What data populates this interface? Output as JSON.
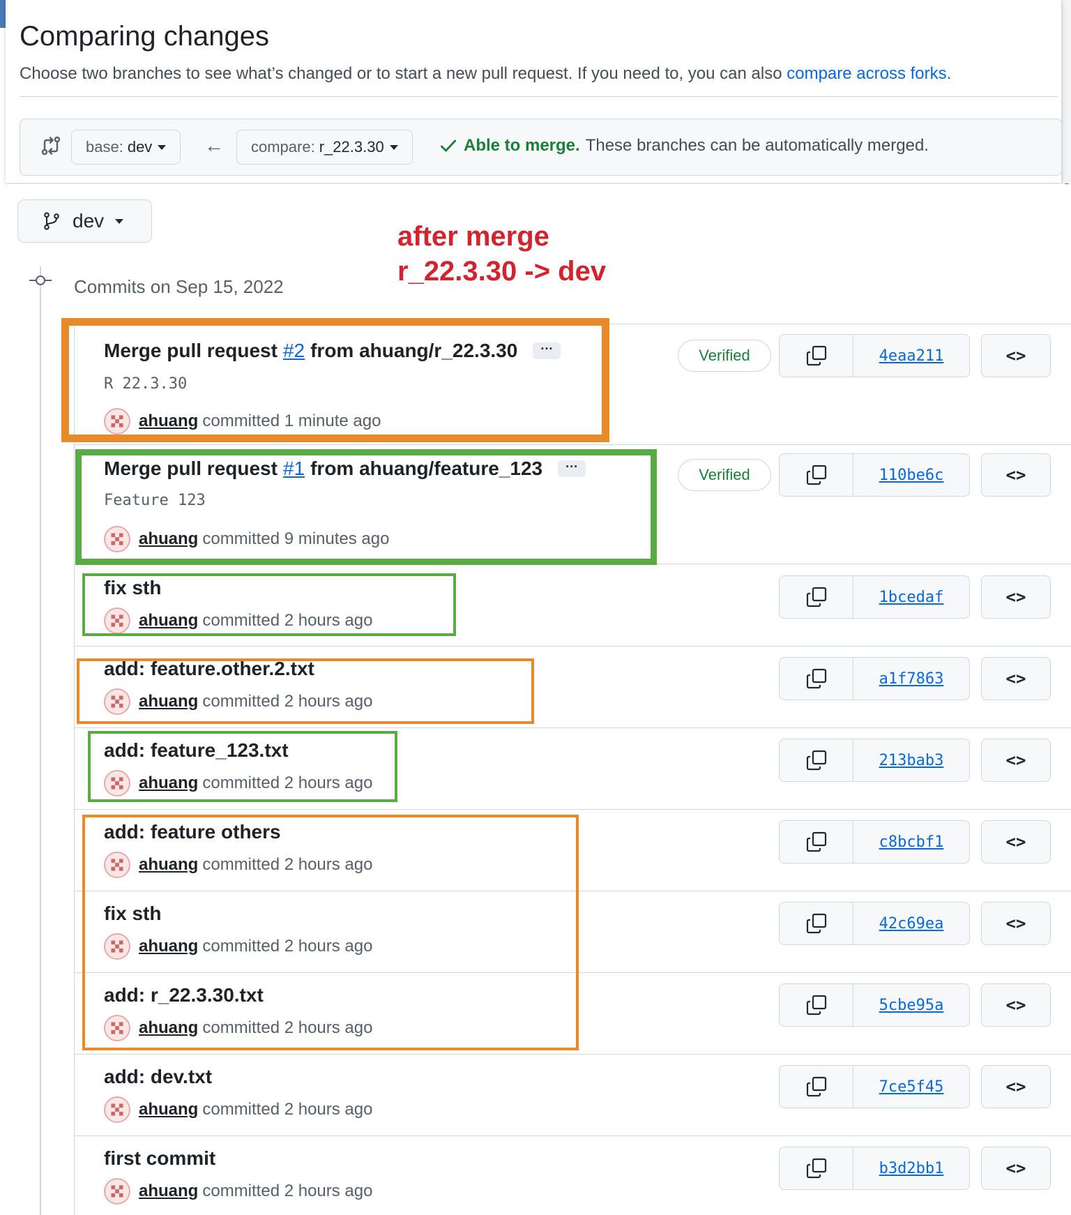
{
  "header": {
    "title": "Comparing changes",
    "description": "Choose two branches to see what’s changed or to start a new pull request. If you need to, you can also ",
    "forks_link": "compare across forks."
  },
  "range": {
    "base_label": "base:",
    "base_branch": "dev",
    "compare_label": "compare:",
    "compare_branch": "r_22.3.30",
    "merge_ok": "Able to merge.",
    "merge_text": "These branches can be automatically merged."
  },
  "branch_selector": {
    "branch": "dev"
  },
  "annotation": {
    "line1": "after merge",
    "line2": "r_22.3.30 -> dev"
  },
  "commit_group": {
    "heading": "Commits on Sep 15, 2022"
  },
  "commits": [
    {
      "title_pre": "Merge pull request",
      "pr": "#2",
      "title_post": "from ahuang/r_22.3.30",
      "body": "R 22.3.30",
      "author": "ahuang",
      "time": "committed 1 minute ago",
      "verified": "Verified",
      "sha": "4eaa211"
    },
    {
      "title_pre": "Merge pull request",
      "pr": "#1",
      "title_post": "from ahuang/feature_123",
      "body": "Feature 123",
      "author": "ahuang",
      "time": "committed 9 minutes ago",
      "verified": "Verified",
      "sha": "110be6c"
    },
    {
      "title": "fix sth",
      "author": "ahuang",
      "time": "committed 2 hours ago",
      "sha": "1bcedaf"
    },
    {
      "title": "add: feature.other.2.txt",
      "author": "ahuang",
      "time": "committed 2 hours ago",
      "sha": "a1f7863"
    },
    {
      "title": "add: feature_123.txt",
      "author": "ahuang",
      "time": "committed 2 hours ago",
      "sha": "213bab3"
    },
    {
      "title": "add: feature others",
      "author": "ahuang",
      "time": "committed 2 hours ago",
      "sha": "c8bcbf1"
    },
    {
      "title": "fix sth",
      "author": "ahuang",
      "time": "committed 2 hours ago",
      "sha": "42c69ea"
    },
    {
      "title": "add: r_22.3.30.txt",
      "author": "ahuang",
      "time": "committed 2 hours ago",
      "sha": "5cbe95a"
    },
    {
      "title": "add: dev.txt",
      "author": "ahuang",
      "time": "committed 2 hours ago",
      "sha": "7ce5f45"
    },
    {
      "title": "first commit",
      "author": "ahuang",
      "time": "committed 2 hours ago",
      "sha": "b3d2bb1"
    }
  ],
  "icons": {
    "compare": "git-compare-icon",
    "branch": "git-branch-icon",
    "commit": "git-commit-icon",
    "copy": "copy-icon",
    "browse": "code-icon",
    "check": "check-icon"
  },
  "colors": {
    "link": "#0969da",
    "success": "#1a7f37",
    "annotation": "#d1242f",
    "highlight_orange": "#e88a2a",
    "highlight_green": "#5aaa45"
  },
  "labels": {
    "ellipsis": "···",
    "browse": "<>",
    "right_edge": "e"
  }
}
